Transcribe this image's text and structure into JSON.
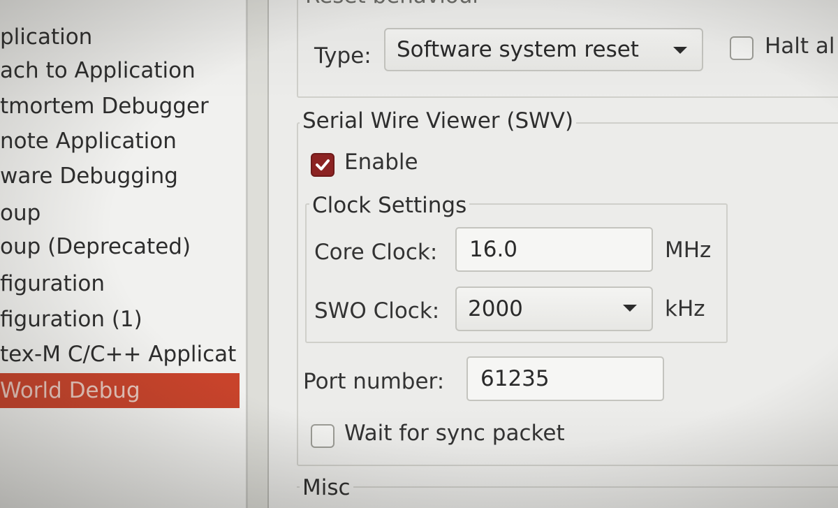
{
  "tree": {
    "items": [
      {
        "label": "plication",
        "selected": false
      },
      {
        "label": "ach to Application",
        "selected": false
      },
      {
        "label": "tmortem Debugger",
        "selected": false
      },
      {
        "label": "note Application",
        "selected": false
      },
      {
        "label": "ware Debugging",
        "selected": false
      },
      {
        "label": "oup",
        "selected": false
      },
      {
        "label": "oup (Deprecated)",
        "selected": false
      },
      {
        "label": "figuration",
        "selected": false
      },
      {
        "label": "figuration (1)",
        "selected": false
      },
      {
        "label": "tex-M C/C++ Applicat",
        "selected": false
      },
      {
        "label": "World Debug",
        "selected": true
      }
    ],
    "selected_color": "#c8432b"
  },
  "reset": {
    "group_title": "Reset behaviour",
    "type_label": "Type:",
    "type_value": "Software system reset",
    "halt_label": "Halt al",
    "halt_checked": false
  },
  "swv": {
    "group_title": "Serial Wire Viewer (SWV)",
    "enable_label": "Enable",
    "enable_checked": true,
    "clock": {
      "group_title": "Clock Settings",
      "core_label": "Core Clock:",
      "core_value": "16.0",
      "core_unit": "MHz",
      "swo_label": "SWO Clock:",
      "swo_value": "2000",
      "swo_unit": "kHz"
    },
    "port_label": "Port number:",
    "port_value": "61235",
    "sync_label": "Wait for sync packet",
    "sync_checked": false
  },
  "misc": {
    "group_title": "Misc"
  },
  "colors": {
    "checkbox_checked": "#8c2323",
    "panel_bg": "#ececea"
  }
}
